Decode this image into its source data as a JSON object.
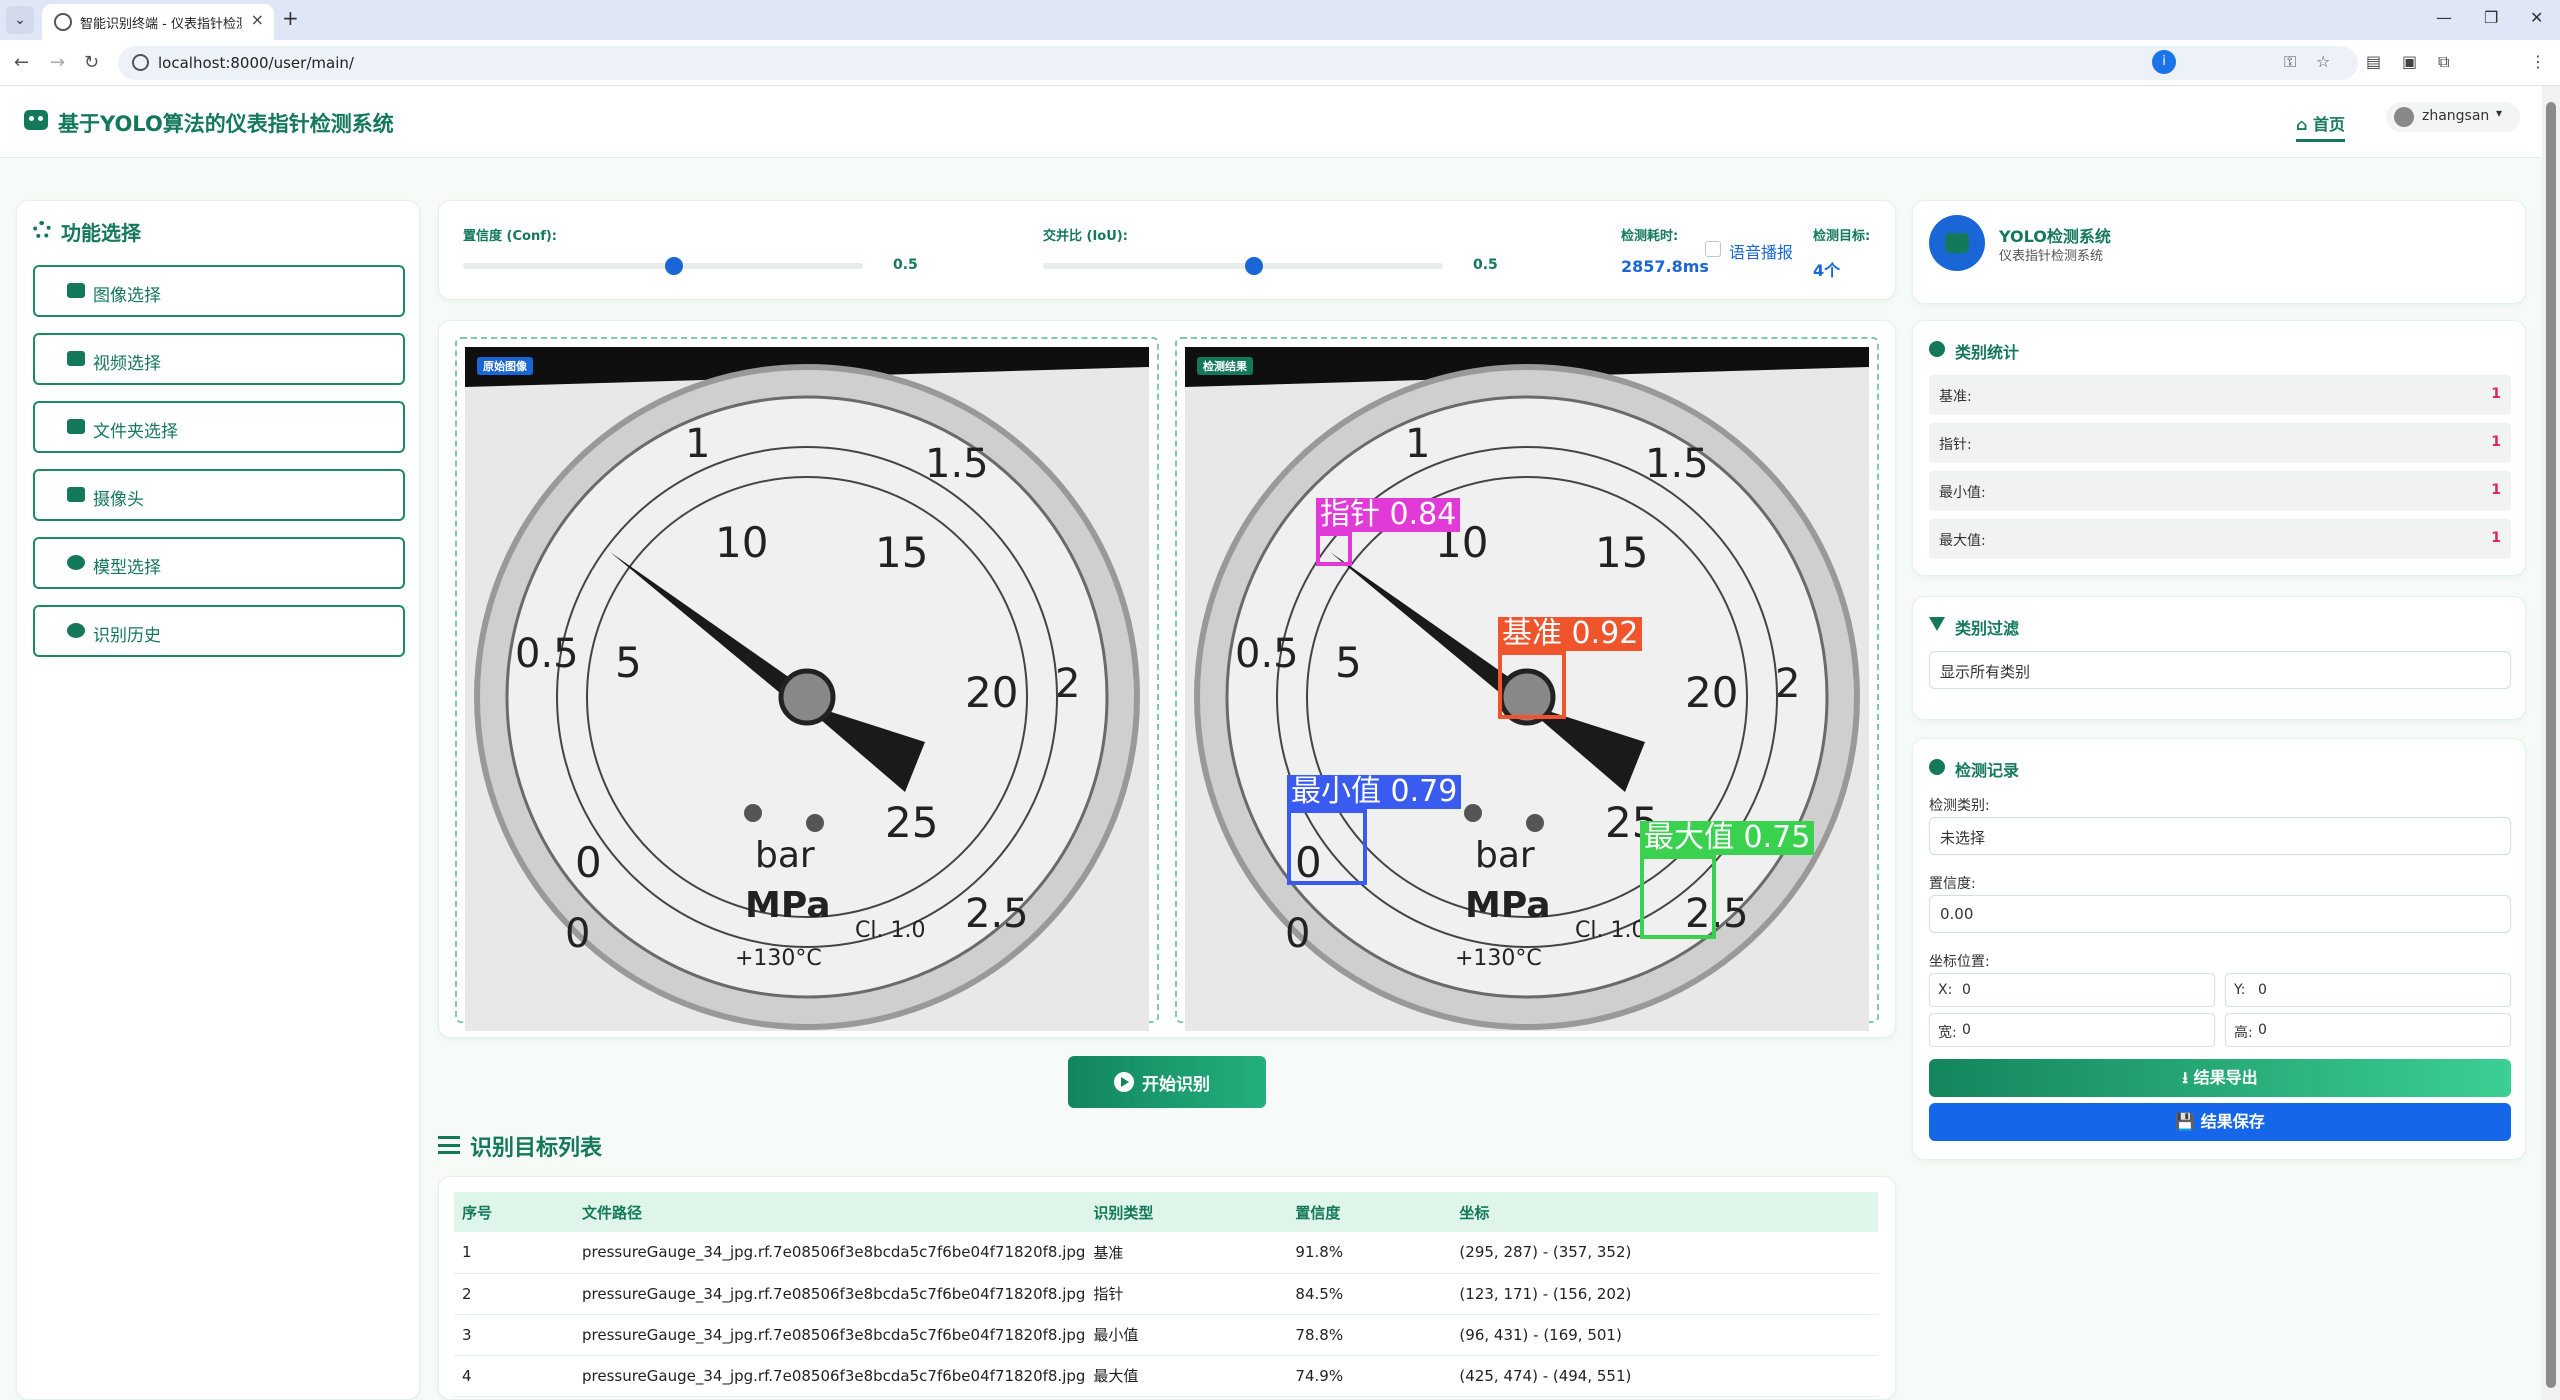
{
  "browser": {
    "tab_title": "智能识别终端 - 仪表指针检测系统",
    "url": "localhost:8000/user/main/"
  },
  "header": {
    "title": "基于YOLO算法的仪表指针检测系统",
    "home_label": "首页",
    "username": "zhangsan"
  },
  "sidebar": {
    "title": "功能选择",
    "items": [
      {
        "label": "图像选择",
        "icon": "image-icon"
      },
      {
        "label": "视频选择",
        "icon": "video-icon"
      },
      {
        "label": "文件夹选择",
        "icon": "folder-icon"
      },
      {
        "label": "摄像头",
        "icon": "camera-icon"
      },
      {
        "label": "模型选择",
        "icon": "brain-icon"
      },
      {
        "label": "识别历史",
        "icon": "history-icon"
      }
    ]
  },
  "controls": {
    "conf_label": "置信度 (Conf):",
    "conf_value": "0.5",
    "iou_label": "交并比 (IoU):",
    "iou_value": "0.5",
    "time_label": "检测耗时:",
    "time_value": "2857.8ms",
    "voice_label": "语音播报",
    "target_label": "检测目标:",
    "target_value": "4个"
  },
  "images": {
    "original_tag": "原始图像",
    "result_tag": "检测结果"
  },
  "gauge": {
    "ticks": [
      "0",
      "5",
      "10",
      "15",
      "20",
      "25"
    ],
    "inner_ticks": [
      "0",
      "0.5",
      "1",
      "1.5",
      "2",
      "2.5"
    ],
    "unit_bar": "bar",
    "unit_mpa": "MPa",
    "temp": "+130°C",
    "class": "Cl. 1.0"
  },
  "detections": [
    {
      "label": "基准",
      "conf": "0.92",
      "color": "#f0542d"
    },
    {
      "label": "指针",
      "conf": "0.84",
      "color": "#e23ad6"
    },
    {
      "label": "最小值",
      "conf": "0.79",
      "color": "#3a5bef"
    },
    {
      "label": "最大值",
      "conf": "0.75",
      "color": "#3ad14f"
    }
  ],
  "start_button": "开始识别",
  "results": {
    "title": "识别目标列表",
    "columns": [
      "序号",
      "文件路径",
      "识别类型",
      "置信度",
      "坐标"
    ],
    "rows": [
      [
        "1",
        "pressureGauge_34_jpg.rf.7e08506f3e8bcda5c7f6be04f71820f8.jpg",
        "基准",
        "91.8%",
        "(295, 287) - (357, 352)"
      ],
      [
        "2",
        "pressureGauge_34_jpg.rf.7e08506f3e8bcda5c7f6be04f71820f8.jpg",
        "指针",
        "84.5%",
        "(123, 171) - (156, 202)"
      ],
      [
        "3",
        "pressureGauge_34_jpg.rf.7e08506f3e8bcda5c7f6be04f71820f8.jpg",
        "最小值",
        "78.8%",
        "(96, 431) - (169, 501)"
      ],
      [
        "4",
        "pressureGauge_34_jpg.rf.7e08506f3e8bcda5c7f6be04f71820f8.jpg",
        "最大值",
        "74.9%",
        "(425, 474) - (494, 551)"
      ]
    ]
  },
  "brand": {
    "title": "YOLO检测系统",
    "subtitle": "仪表指针检测系统"
  },
  "class_stats": {
    "title": "类别统计",
    "items": [
      {
        "name": "基准:",
        "count": "1"
      },
      {
        "name": "指针:",
        "count": "1"
      },
      {
        "name": "最小值:",
        "count": "1"
      },
      {
        "name": "最大值:",
        "count": "1"
      }
    ]
  },
  "class_filter": {
    "title": "类别过滤",
    "value": "显示所有类别"
  },
  "detect_record": {
    "title": "检测记录",
    "class_label": "检测类别:",
    "class_value": "未选择",
    "conf_label": "置信度:",
    "conf_value": "0.00",
    "pos_label": "坐标位置:",
    "x_label": "X:",
    "x_value": "0",
    "y_label": "Y:",
    "y_value": "0",
    "w_label": "宽:",
    "w_value": "0",
    "h_label": "高:",
    "h_value": "0",
    "export_label": "结果导出",
    "save_label": "结果保存"
  }
}
